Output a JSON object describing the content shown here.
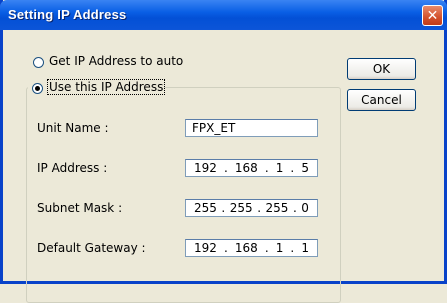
{
  "window": {
    "title": "Setting IP Address"
  },
  "options": {
    "auto_label": "Get IP Address to auto",
    "manual_label": "Use this IP Address"
  },
  "fields": {
    "unit_name_label": "Unit Name :",
    "unit_name_value": "FPX_ET",
    "ip_label": "IP Address :",
    "ip": [
      "192",
      "168",
      "1",
      "5"
    ],
    "subnet_label": "Subnet Mask :",
    "subnet": [
      "255",
      "255",
      "255",
      "0"
    ],
    "gateway_label": "Default Gateway :",
    "gateway": [
      "192",
      "168",
      "1",
      "1"
    ]
  },
  "buttons": {
    "ok": "OK",
    "cancel": "Cancel"
  },
  "icons": {
    "close": "close-icon"
  }
}
